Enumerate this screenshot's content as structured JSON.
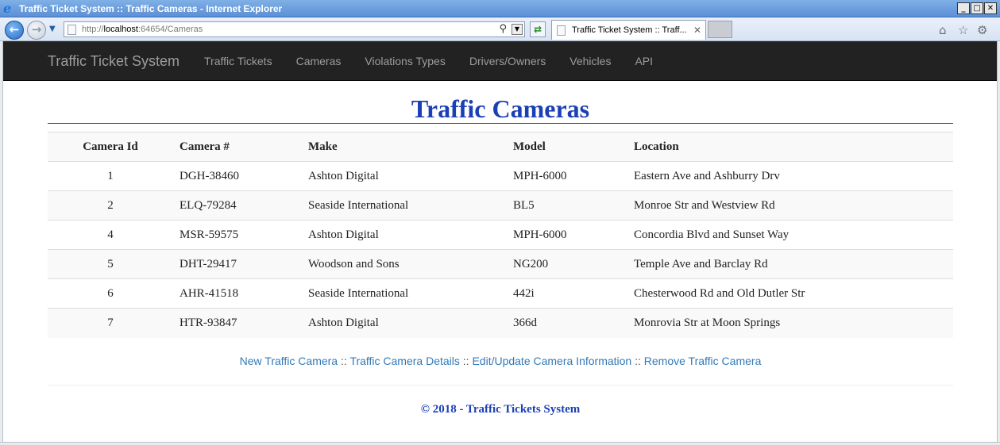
{
  "window": {
    "title": "Traffic Ticket System :: Traffic Cameras - Internet Explorer",
    "minimize": "_",
    "maximize": "□",
    "close": "✕"
  },
  "browser": {
    "url_prefix": "http://",
    "url_host": "localhost",
    "url_rest": ":64654/Cameras",
    "tab_title": "Traffic Ticket System :: Traff...",
    "icons": [
      "back-icon",
      "forward-icon",
      "search-icon",
      "refresh-icon",
      "home-icon",
      "favorites-icon",
      "settings-icon"
    ]
  },
  "nav": {
    "brand": "Traffic Ticket System",
    "links": [
      "Traffic Tickets",
      "Cameras",
      "Violations Types",
      "Drivers/Owners",
      "Vehicles",
      "API"
    ]
  },
  "page": {
    "title": "Traffic Cameras",
    "columns": [
      "Camera Id",
      "Camera #",
      "Make",
      "Model",
      "Location"
    ],
    "rows": [
      [
        "1",
        "DGH-38460",
        "Ashton Digital",
        "MPH-6000",
        "Eastern Ave and Ashburry Drv"
      ],
      [
        "2",
        "ELQ-79284",
        "Seaside International",
        "BL5",
        "Monroe Str and Westview Rd"
      ],
      [
        "4",
        "MSR-59575",
        "Ashton Digital",
        "MPH-6000",
        "Concordia Blvd and Sunset Way"
      ],
      [
        "5",
        "DHT-29417",
        "Woodson and Sons",
        "NG200",
        "Temple Ave and Barclay Rd"
      ],
      [
        "6",
        "AHR-41518",
        "Seaside International",
        "442i",
        "Chesterwood Rd and Old Dutler Str"
      ],
      [
        "7",
        "HTR-93847",
        "Ashton Digital",
        "366d",
        "Monrovia Str at Moon Springs"
      ]
    ],
    "actions": [
      "New Traffic Camera",
      "Traffic Camera Details",
      "Edit/Update Camera Information",
      "Remove Traffic Camera"
    ],
    "action_separator": "::",
    "footer": "© 2018 - Traffic Tickets System"
  },
  "colors": {
    "heading": "#1b3fb5",
    "navbar_bg": "#222222",
    "link": "#337ab7"
  }
}
